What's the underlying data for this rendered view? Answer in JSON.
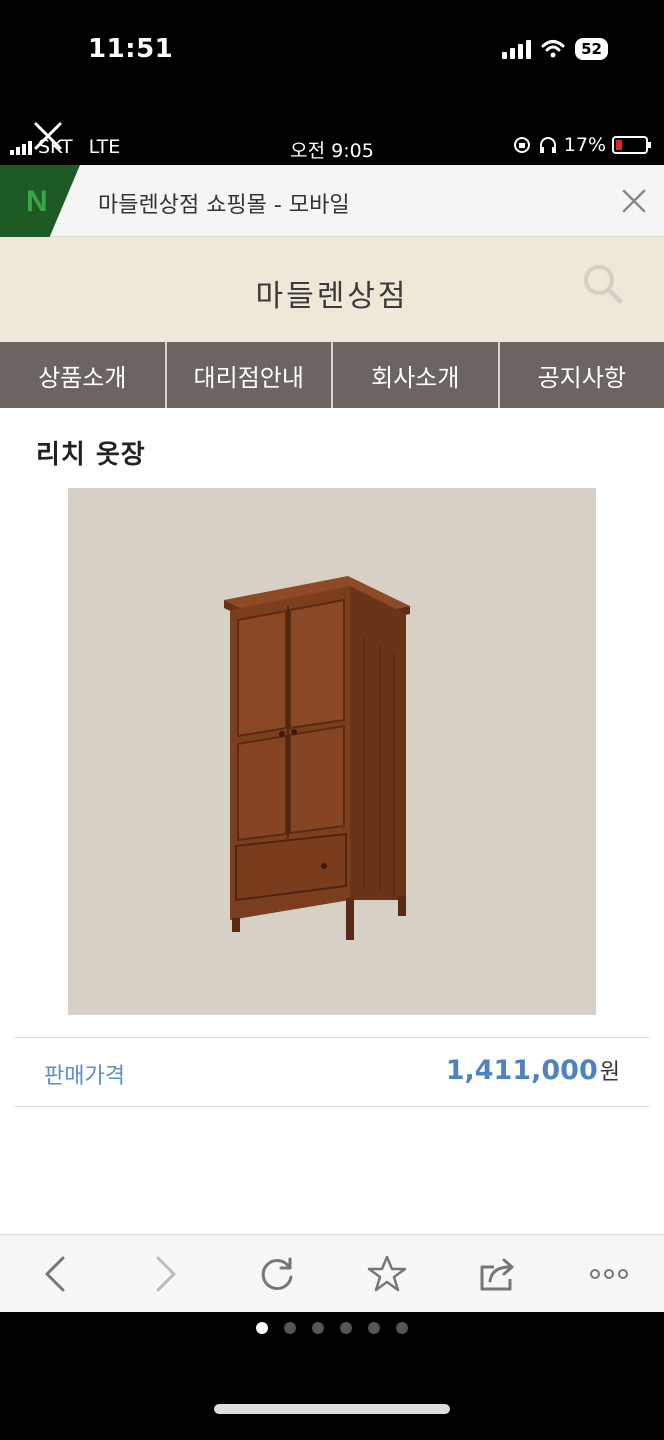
{
  "outer_status": {
    "time": "11:51",
    "battery": "52"
  },
  "inner_status": {
    "carrier": "SKT",
    "network": "LTE",
    "time": "오전 9:05",
    "battery": "17%"
  },
  "titlebar": {
    "title": "마들렌상점 쇼핑몰 - 모바일"
  },
  "site": {
    "logo": "마들렌상점"
  },
  "nav": {
    "items": [
      "상품소개",
      "대리점안내",
      "회사소개",
      "공지사항"
    ]
  },
  "product": {
    "name": "리치 옷장",
    "price_label": "판매가격",
    "price_value": "1,411,000",
    "price_unit": "원"
  },
  "pager": {
    "count": 6,
    "active": 0
  },
  "colors": {
    "nav_bg": "#6b6460",
    "header_bg": "#efe7d8",
    "price_blue": "#4f82c0",
    "wood": "#7a3e1f"
  }
}
